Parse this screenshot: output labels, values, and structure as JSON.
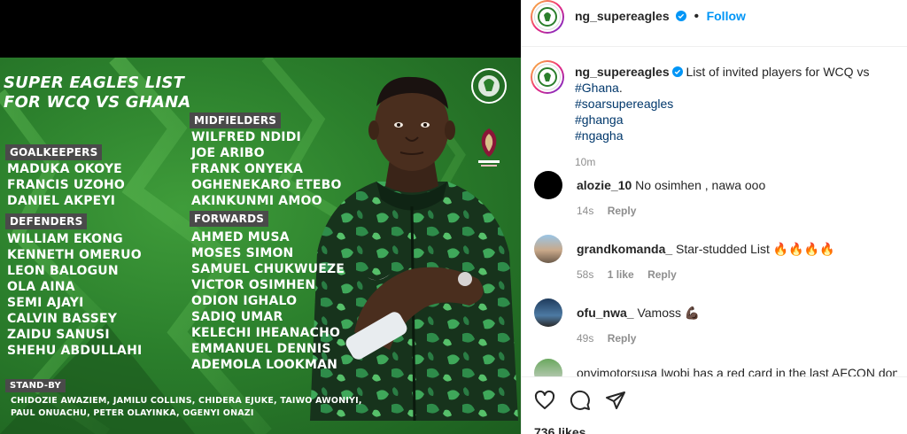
{
  "poster": {
    "title_line1": "SUPER EAGLES LIST",
    "title_line2": "FOR WCQ VS GHANA",
    "goalkeepers_header": "GOALKEEPERS",
    "goalkeepers": [
      "MADUKA OKOYE",
      "FRANCIS UZOHO",
      "DANIEL AKPEYI"
    ],
    "defenders_header": "DEFENDERS",
    "defenders": [
      "WILLIAM EKONG",
      "KENNETH OMERUO",
      "LEON BALOGUN",
      "OLA AINA",
      "SEMI AJAYI",
      "CALVIN BASSEY",
      "ZAIDU SANUSI",
      "SHEHU ABDULLAHI"
    ],
    "midfielders_header": "MIDFIELDERS",
    "midfielders": [
      "WILFRED NDIDI",
      "JOE ARIBO",
      "FRANK ONYEKA",
      "OGHENEKARO ETEBO",
      "AKINKUNMI AMOO"
    ],
    "forwards_header": "FORWARDS",
    "forwards": [
      "AHMED MUSA",
      "MOSES SIMON",
      "SAMUEL CHUKWUEZE",
      "VICTOR OSIMHEN",
      "ODION IGHALO",
      "SADIQ UMAR",
      "KELECHI IHEANACHO",
      "EMMANUEL DENNIS",
      "ADEMOLA LOOKMAN"
    ],
    "standby_header": "STAND-BY",
    "standby_line1": "CHIDOZIE AWAZIEM, JAMILU COLLINS, CHIDERA EJUKE, TAIWO AWONIYI,",
    "standby_line2": "PAUL ONUACHU, PETER OLAYINKA, OGENYI ONAZI",
    "colors": {
      "green_dark": "#1c5d1f",
      "green_light": "#3f9c3a",
      "header_bg": "#4a4a4a"
    }
  },
  "header": {
    "username": "ng_supereagles",
    "separator": "•",
    "follow_label": "Follow"
  },
  "caption": {
    "username": "ng_supereagles",
    "text": "List of invited players for WCQ vs ",
    "mention": "#Ghana",
    "text_end": ".",
    "tags": [
      "#soarsupereagles",
      "#ghanga",
      "#ngagha"
    ],
    "time": "10m"
  },
  "comments": [
    {
      "user": "alozie_10",
      "text": "No osimhen , nawa ooo",
      "time": "14s",
      "likes": "",
      "reply": "Reply",
      "avatar": "black-circle"
    },
    {
      "user": "grandkomanda_",
      "text": "Star-studded List 🔥🔥🔥🔥",
      "time": "58s",
      "likes": "1 like",
      "reply": "Reply",
      "avatar": "photo"
    },
    {
      "user": "ofu_nwa_",
      "text": "Vamoss 💪🏿",
      "time": "49s",
      "likes": "",
      "reply": "Reply",
      "avatar": "photo"
    },
    {
      "user": "onyimotorsusa",
      "text": "Iwobi has a red card in the last AFCON don't",
      "time": "",
      "likes": "",
      "reply": "",
      "avatar": "photo"
    }
  ],
  "actions": {
    "like_icon": "heart-icon",
    "comment_icon": "comment-icon",
    "share_icon": "share-icon"
  },
  "likes_count": "736 likes",
  "accent": "#0095f6"
}
